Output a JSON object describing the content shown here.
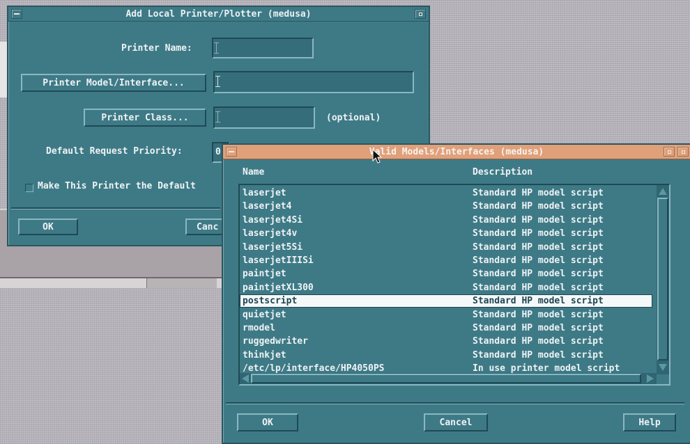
{
  "add_dialog": {
    "title": "Add Local Printer/Plotter (medusa)",
    "printer_name_label": "Printer Name:",
    "model_button": "Printer Model/Interface...",
    "class_button": "Printer Class...",
    "optional_label": "(optional)",
    "priority_label": "Default Request Priority:",
    "priority_value": "0",
    "default_checkbox_label": "Make This Printer the Default",
    "ok_button": "OK",
    "cancel_button": "Canc"
  },
  "models_dialog": {
    "title": "Valid Models/Interfaces (medusa)",
    "columns": {
      "name": "Name",
      "description": "Description"
    },
    "rows": [
      {
        "name": "laserjet",
        "description": "Standard HP model script"
      },
      {
        "name": "laserjet4",
        "description": "Standard HP model script"
      },
      {
        "name": "laserjet4Si",
        "description": "Standard HP model script"
      },
      {
        "name": "laserjet4v",
        "description": "Standard HP model script"
      },
      {
        "name": "laserjet5Si",
        "description": "Standard HP model script"
      },
      {
        "name": "laserjetIIISi",
        "description": "Standard HP model script"
      },
      {
        "name": "paintjet",
        "description": "Standard HP model script"
      },
      {
        "name": "paintjetXL300",
        "description": "Standard HP model script"
      },
      {
        "name": "postscript",
        "description": "Standard HP model script"
      },
      {
        "name": "quietjet",
        "description": "Standard HP model script"
      },
      {
        "name": "rmodel",
        "description": "Standard HP model script"
      },
      {
        "name": "ruggedwriter",
        "description": "Standard HP model script"
      },
      {
        "name": "thinkjet",
        "description": "Standard HP model script"
      },
      {
        "name": "/etc/lp/interface/HP4050PS",
        "description": "In use printer model script"
      }
    ],
    "selected_row": "postscript",
    "ok_button": "OK",
    "cancel_button": "Cancel",
    "help_button": "Help"
  },
  "colors": {
    "dialog_bg": "#3e7a86",
    "active_title": "#e0a07a",
    "desktop": "#b4b1b8"
  }
}
